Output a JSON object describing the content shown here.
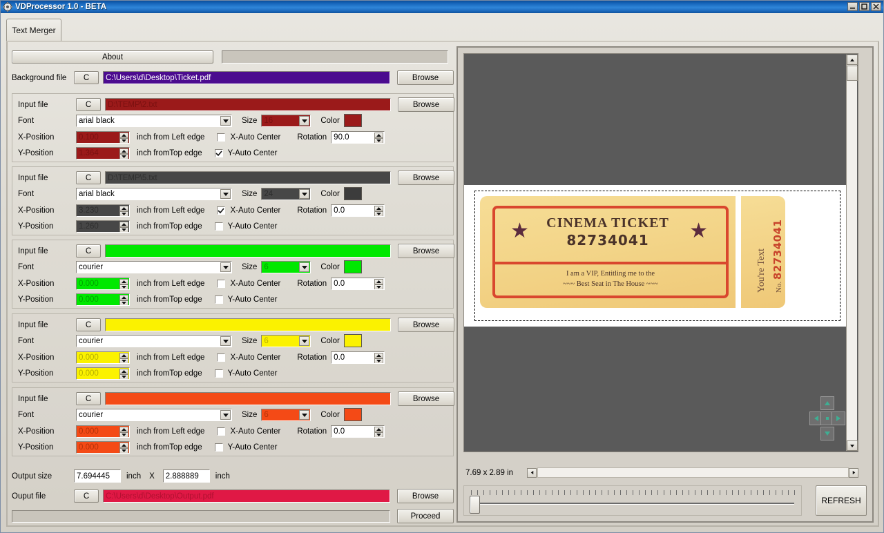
{
  "window": {
    "title": "VDProcessor 1.0 - BETA",
    "icon": "gear-icon",
    "minimize": "–",
    "maximize": "□",
    "close": "✕"
  },
  "tabs": [
    {
      "label": "Text Merger",
      "active": true
    }
  ],
  "toolbar": {
    "about_label": "About",
    "status_text": ""
  },
  "background": {
    "label": "Background file",
    "clear_label": "C",
    "value": "C:\\Users\\d\\Desktop\\Ticket.pdf",
    "browse_label": "Browse",
    "field_bg": "#4b0b8f",
    "field_fg": "#ffffff"
  },
  "labels": {
    "input_file": "Input file",
    "font": "Font",
    "size": "Size",
    "color": "Color",
    "x_position": "X-Position",
    "y_position": "Y-Position",
    "inch_left": "inch from Left edge",
    "inch_top": "inch fromTop edge",
    "x_auto": "X-Auto Center",
    "y_auto": "Y-Auto Center",
    "rotation": "Rotation",
    "clear": "C",
    "browse": "Browse"
  },
  "groups": [
    {
      "id": "group-1",
      "input_file": "D:\\TEMP\\2.txt",
      "font": "arial black",
      "size": "16",
      "x_position": "0.100",
      "y_position": "1.364",
      "x_auto_center": false,
      "y_auto_center": true,
      "rotation": "90.0",
      "color": "#9b1a1a",
      "field_bg": "#9b1a1a",
      "field_fg": "#7a1010",
      "swatch": "#9b1a1a"
    },
    {
      "id": "group-2",
      "input_file": "D:\\TEMP\\5.txt",
      "font": "arial black",
      "size": "24",
      "x_position": "3.230",
      "y_position": "1.260",
      "x_auto_center": true,
      "y_auto_center": false,
      "rotation": "0.0",
      "color": "#474747",
      "field_bg": "#474747",
      "field_fg": "#2e2e2e",
      "swatch": "#3c3c3c"
    },
    {
      "id": "group-3",
      "input_file": "",
      "font": "courier",
      "size": "6",
      "x_position": "0.000",
      "y_position": "0.000",
      "x_auto_center": false,
      "y_auto_center": false,
      "rotation": "0.0",
      "color": "#00e800",
      "field_bg": "#00e800",
      "field_fg": "#00a000",
      "swatch": "#00e800"
    },
    {
      "id": "group-4",
      "input_file": "",
      "font": "courier",
      "size": "6",
      "x_position": "0.000",
      "y_position": "0.000",
      "x_auto_center": false,
      "y_auto_center": false,
      "rotation": "0.0",
      "color": "#fbf200",
      "field_bg": "#fbf200",
      "field_fg": "#b5ae00",
      "swatch": "#fbf200"
    },
    {
      "id": "group-5",
      "input_file": "",
      "font": "courier",
      "size": "6",
      "x_position": "0.000",
      "y_position": "0.000",
      "x_auto_center": false,
      "y_auto_center": false,
      "rotation": "0.0",
      "color": "#f44a16",
      "field_bg": "#f44a16",
      "field_fg": "#b33208",
      "swatch": "#f44a16"
    }
  ],
  "output": {
    "size_label": "Output size",
    "width": "7.694445",
    "inch_label_1": "inch",
    "x_label": "X",
    "height": "2.888889",
    "inch_label_2": "inch",
    "file_label": "Ouput file",
    "clear_label": "C",
    "file_value": "C:\\Users\\d\\Desktop\\Output.pdf",
    "file_bg": "#e01845",
    "file_fg": "#b01030",
    "browse_label": "Browse",
    "proceed_label": "Proceed",
    "progress_text": ""
  },
  "preview": {
    "status": "7.69 x 2.89 in",
    "refresh_label": "REFRESH",
    "nav": {
      "up": "nav-up",
      "down": "nav-down",
      "left": "nav-left",
      "right": "nav-right",
      "center": "nav-center"
    },
    "ticket": {
      "title": "CINEMA TICKET",
      "number": "82734041",
      "vip_line_1": "I am a VIP, Entitling me to the",
      "vip_line_2": "~~~ Best Seat in The House ~~~",
      "stub_text": "You're Text",
      "stub_prefix": "No.",
      "stub_number": "82734041",
      "star_left": "★",
      "star_right": "★"
    }
  }
}
